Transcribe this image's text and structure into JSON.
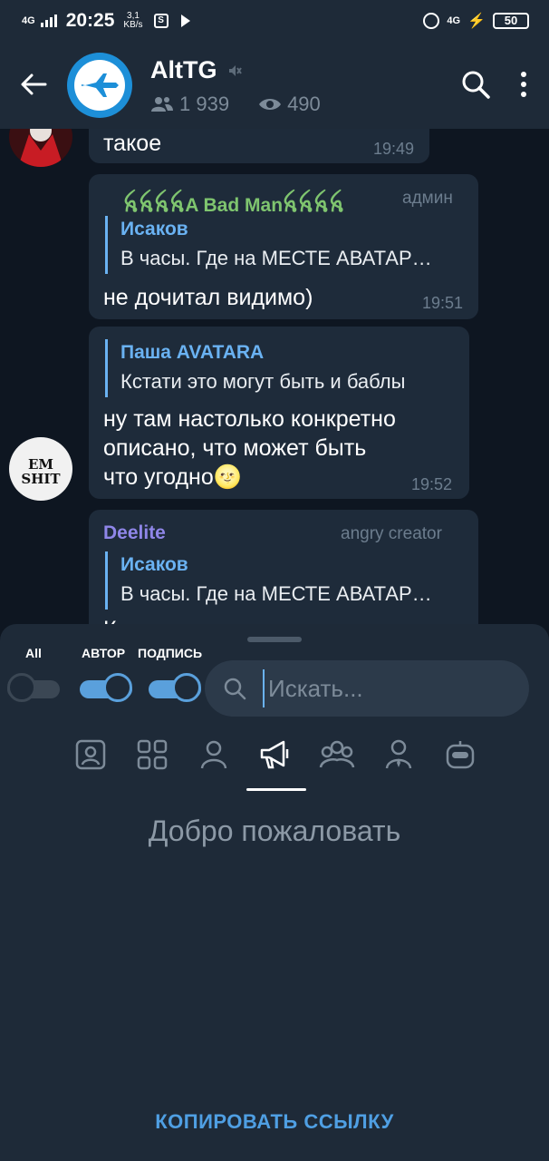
{
  "status": {
    "network_left": "4G",
    "time": "20:25",
    "speed_value": "3,1",
    "speed_unit": "KB/s",
    "network_right": "4G",
    "battery": "50"
  },
  "header": {
    "title": "AltTG",
    "subscribers": "1 939",
    "views": "490",
    "icons": [
      "back-arrow-icon",
      "mute-icon",
      "people-icon",
      "eye-icon",
      "search-icon",
      "more-icon"
    ]
  },
  "messages": [
    {
      "text": "такое",
      "time": "19:49"
    },
    {
      "sender": "ꫝꫝꫝꫝA Bad Manꫝꫝꫝꫝ",
      "sender_color": "#7fc56f",
      "role": "админ",
      "reply_name": "Исаков",
      "reply_text": "В часы. Где на МЕСТЕ АВАТАР…",
      "text": "не дочитал видимо)",
      "time": "19:51"
    },
    {
      "reply_name": "Паша AVATARA",
      "reply_text": "Кстати это могут быть и баблы",
      "text_lines": [
        "ну там настолько конкретно",
        "описано, что может быть",
        "что угодно🌝"
      ],
      "time": "19:52",
      "avatar_text": "EM SHIT"
    },
    {
      "sender": "Deelite",
      "sender_color": "#8f86e8",
      "role": "angry creator",
      "reply_name": "Исаков",
      "reply_text": "В часы. Где на МЕСТЕ АВАТАР…",
      "text_partial": "К"
    }
  ],
  "sheet": {
    "toggles": [
      {
        "label": "All",
        "on": false
      },
      {
        "label": "АВТОР",
        "on": true
      },
      {
        "label": "ПОДПИСЬ",
        "on": true
      }
    ],
    "search_placeholder": "Искать...",
    "tabs": [
      "profile-card-icon",
      "grid-icon",
      "user-icon",
      "megaphone-icon",
      "group-icon",
      "user-tie-icon",
      "bot-icon"
    ],
    "active_tab": 3,
    "welcome": "Добро пожаловать",
    "copy_link": "КОПИРОВАТЬ ССЫЛКУ",
    "accent": "#5aa0dc"
  }
}
